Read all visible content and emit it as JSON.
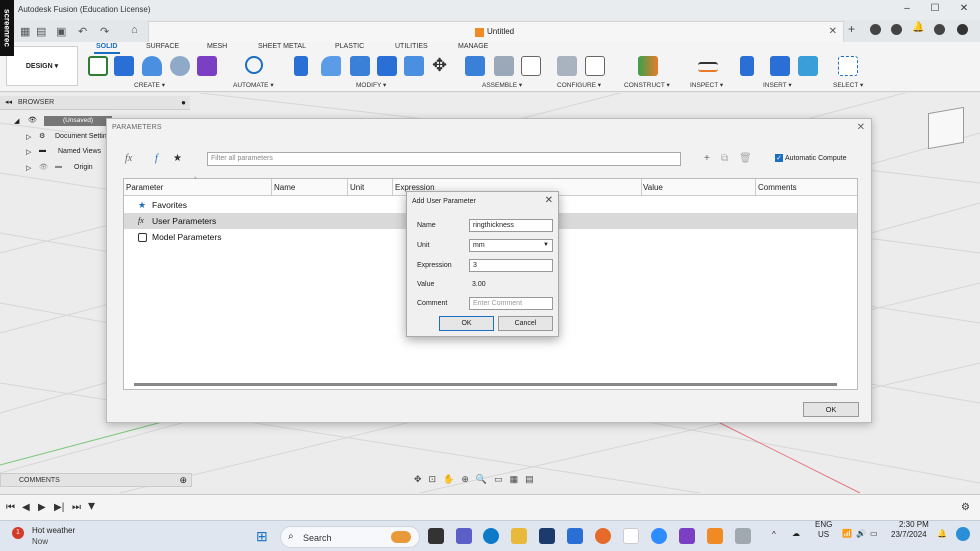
{
  "app": {
    "title": "Autodesk Fusion (Education License)",
    "recorder_badge": "screenrec"
  },
  "doc_tab": {
    "name": "Untitled"
  },
  "toolbar": {
    "workspace_button": "DESIGN ▾",
    "tabs": [
      "SOLID",
      "SURFACE",
      "MESH",
      "SHEET METAL",
      "PLASTIC",
      "UTILITIES",
      "MANAGE"
    ],
    "groups": [
      "CREATE ▾",
      "AUTOMATE ▾",
      "MODIFY ▾",
      "ASSEMBLE ▾",
      "CONFIGURE ▾",
      "CONSTRUCT ▾",
      "INSPECT ▾",
      "INSERT ▾",
      "SELECT ▾"
    ]
  },
  "browser": {
    "title": "BROWSER",
    "root": "(Unsaved)",
    "items": [
      "Document Settin",
      "Named Views",
      "Origin"
    ]
  },
  "parameters": {
    "title": "PARAMETERS",
    "filter_placeholder": "Filter all parameters",
    "auto_compute": "Automatic Compute",
    "columns": [
      "Parameter",
      "Name",
      "Unit",
      "Expression",
      "Value",
      "Comments"
    ],
    "rows": [
      "Favorites",
      "User Parameters",
      "Model Parameters"
    ],
    "ok_label": "OK"
  },
  "add_user_parameter": {
    "title": "Add User Parameter",
    "name_label": "Name",
    "name_value": "ringthickness",
    "unit_label": "Unit",
    "unit_value": "mm",
    "expression_label": "Expression",
    "expression_value": "3",
    "value_label": "Value",
    "value_value": "3.00",
    "comment_label": "Comment",
    "comment_placeholder": "Enter Comment",
    "ok_label": "OK",
    "cancel_label": "Cancel"
  },
  "comments": {
    "title": "COMMENTS"
  },
  "taskbar": {
    "weather_title": "Hot weather",
    "weather_sub": "Now",
    "weather_badge": "1",
    "search_label": "Search",
    "lang_top": "ENG",
    "lang_bottom": "US",
    "time": "2:30 PM",
    "date": "23/7/2024"
  },
  "colors": {
    "accent": "#1a6fc2",
    "fusion_orange": "#f08a24"
  }
}
